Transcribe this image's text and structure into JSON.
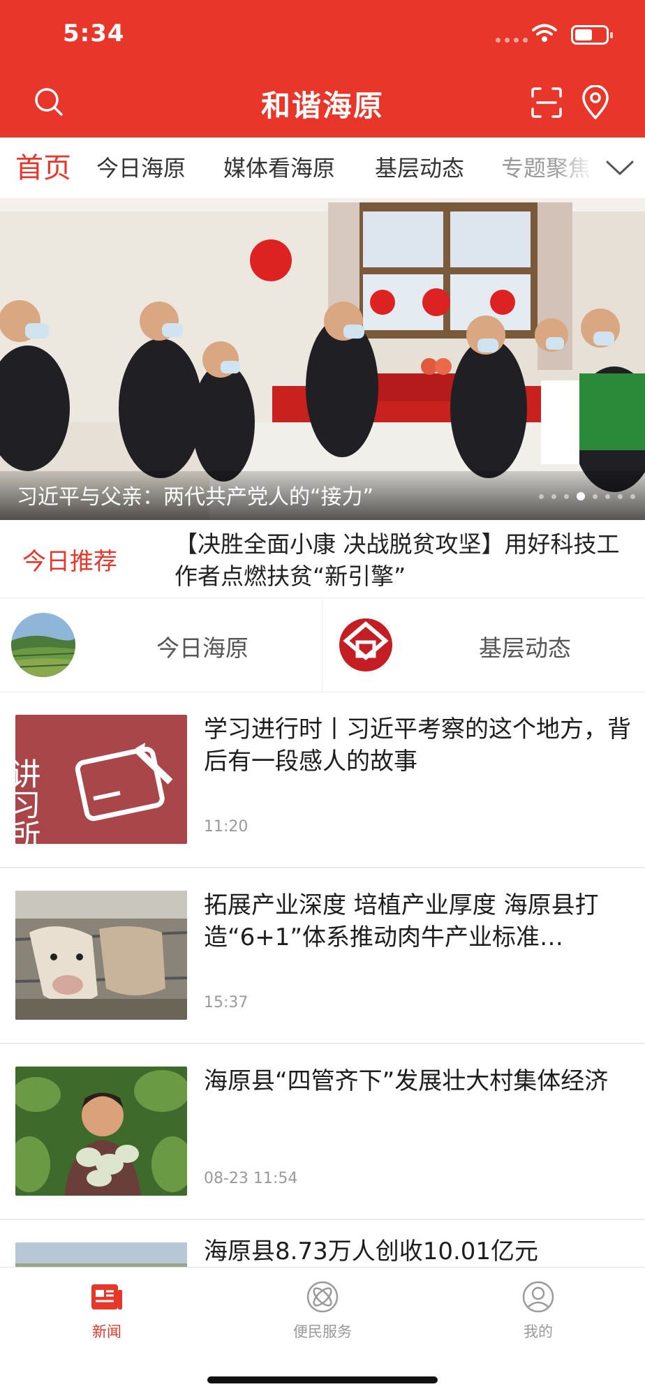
{
  "status_bar": {
    "time": "5:34"
  },
  "header": {
    "title": "和谐海原"
  },
  "tabs": [
    {
      "label": "首页",
      "active": true
    },
    {
      "label": "今日海原"
    },
    {
      "label": "媒体看海原"
    },
    {
      "label": "基层动态"
    },
    {
      "label": "专题聚焦"
    }
  ],
  "banner": {
    "caption": "习近平与父亲：两代共产党人的“接力”",
    "dot_count": 8,
    "active_dot": 4
  },
  "recommend": {
    "label": "今日推荐",
    "text": "【决胜全面小康 决战脱贫攻坚】用好科技工作者点燃扶贫“新引擎”"
  },
  "quick_entries": [
    {
      "label": "今日海原",
      "icon": "landscape-photo"
    },
    {
      "label": "基层动态",
      "icon": "red-logo"
    }
  ],
  "news": [
    {
      "title": "学习进行时丨习近平考察的这个地方，背后有一段感人的故事",
      "time": "11:20",
      "thumb": "讲习所",
      "thumb_icon": "notebook-pen"
    },
    {
      "title": " 拓展产业深度 培植产业厚度 海原县打造“6+1”体系推动肉牛产业标准…",
      "time": "15:37",
      "thumb_icon": "cattle-photo"
    },
    {
      "title": "海原县“四管齐下”发展壮大村集体经济",
      "time": "08-23 11:54",
      "thumb_icon": "farmer-photo"
    },
    {
      "title": "海原县8.73万人创收10.01亿元",
      "time": "",
      "thumb_icon": "landscape-photo"
    }
  ],
  "bottom_nav": [
    {
      "label": "新闻",
      "icon": "news-icon",
      "active": true
    },
    {
      "label": "便民服务",
      "icon": "service-icon"
    },
    {
      "label": "我的",
      "icon": "profile-icon"
    }
  ],
  "colors": {
    "brand": "#e8362a",
    "text": "#222222",
    "muted": "#999999"
  }
}
